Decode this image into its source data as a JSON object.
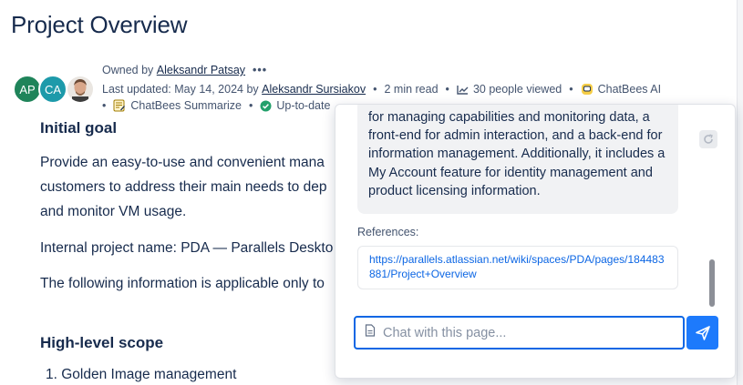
{
  "page": {
    "title": "Project Overview"
  },
  "byline": {
    "avatars": [
      {
        "initials": "AP",
        "color": "#1f845a"
      },
      {
        "initials": "CA",
        "color": "#1d9aaa"
      }
    ],
    "owned_by_label": "Owned by",
    "owner": "Aleksandr Patsay",
    "more": "•••",
    "updated_label": "Last updated: May 14, 2024 by",
    "updated_by": "Aleksandr Sursiakov",
    "read_time": "2 min read",
    "views": "30 people viewed",
    "chatbees_ai": "ChatBees AI",
    "chatbees_summarize": "ChatBees Summarize",
    "status": "Up-to-date"
  },
  "content": {
    "initial_goal_heading": "Initial goal",
    "goal_text": "Provide an easy-to-use and convenient mana customers to address their main needs to dep and monitor VM usage.",
    "internal_name": "Internal project name: PDA — Parallels Deskto",
    "applicable": "The following information is applicable only to",
    "scope_heading": "High-level scope",
    "scope_item_1": "1. Golden Image management"
  },
  "chat": {
    "answer_text": "for managing capabilities and monitoring data, a front-end for admin interaction, and a back-end for information management. Additionally, it includes a My Account feature for identity management and product licensing information.",
    "references_label": "References:",
    "reference_url": "https://parallels.atlassian.net/wiki/spaces/PDA/pages/184483881/Project+Overview",
    "input_placeholder": "Chat with this page...",
    "accent_color": "#1d7afc"
  }
}
